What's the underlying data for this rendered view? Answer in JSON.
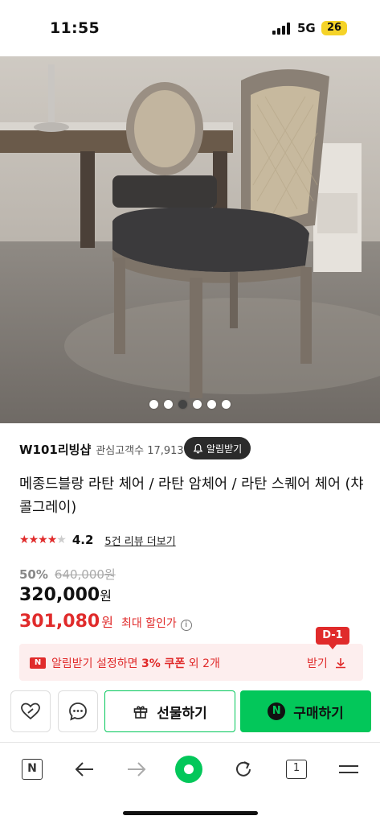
{
  "status_bar": {
    "time": "11:55",
    "network": "5G",
    "battery": "26"
  },
  "gallery": {
    "dot_count": 6,
    "active_index": 2
  },
  "seller": {
    "name": "W101리빙샵",
    "followers": "관심고객수 17,913",
    "alarm_label": "알림받기"
  },
  "product": {
    "title": "메종드블랑 라탄 체어 / 라탄 암체어 / 라탄 스퀘어 체어 (챠콜그레이)",
    "rating": "4.2",
    "rating_value": 4.2,
    "review_link": "5건 리뷰 더보기",
    "discount": "50%",
    "original_price": "640,000원",
    "sale_price": "320,000",
    "sale_unit": "원",
    "max_price": "301,080",
    "max_unit": "원",
    "max_label": "최대 할인가"
  },
  "coupon": {
    "badge": "D-1",
    "n_label": "N",
    "text_before": "알림받기 설정하면 ",
    "highlight": "3% 쿠폰",
    "text_after": " 외 2개",
    "download_label": "받기"
  },
  "actions": {
    "like_icon": "heart-icon",
    "chat_icon": "chat-icon",
    "gift_label": "선물하기",
    "buy_label": "구매하기",
    "buy_n": "N"
  },
  "browser_nav": {
    "tab_count": "1",
    "n_label": "N"
  },
  "colors": {
    "accent_green": "#03c75a",
    "accent_red": "#e02b2b"
  }
}
